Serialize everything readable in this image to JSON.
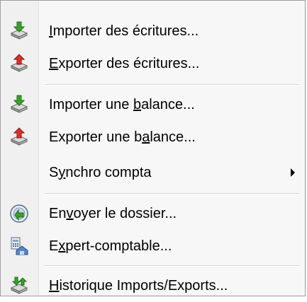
{
  "menu": {
    "items": [
      {
        "pre": "",
        "key": "I",
        "post": "mporter des écritures...",
        "icon": "import-entries-icon"
      },
      {
        "pre": "",
        "key": "E",
        "post": "xporter des écritures...",
        "icon": "export-entries-icon"
      },
      {
        "pre": "Importer une ",
        "key": "b",
        "post": "alance...",
        "icon": "import-balance-icon"
      },
      {
        "pre": "Exporter une b",
        "key": "a",
        "post": "lance...",
        "icon": "export-balance-icon"
      },
      {
        "pre": "S",
        "key": "y",
        "post": "nchro compta",
        "icon": ""
      },
      {
        "pre": "En",
        "key": "v",
        "post": "oyer le dossier...",
        "icon": "send-folder-icon"
      },
      {
        "pre": "E",
        "key": "x",
        "post": "pert-comptable...",
        "icon": "accountant-icon"
      },
      {
        "pre": "",
        "key": "H",
        "post": "istorique Imports/Exports...",
        "icon": "history-icon"
      }
    ]
  },
  "colors": {
    "import_arrow": "#3aa02a",
    "export_arrow": "#d8322a"
  }
}
